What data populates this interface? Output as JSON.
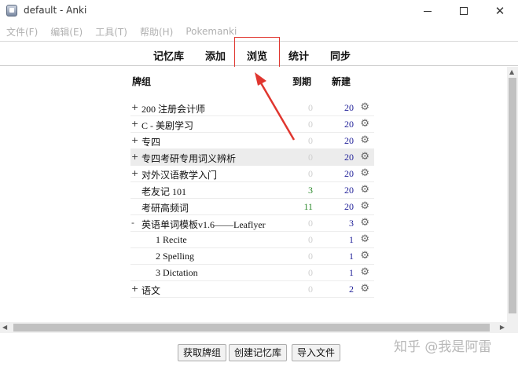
{
  "window": {
    "title": "default - Anki"
  },
  "menu": [
    "文件(F)",
    "编辑(E)",
    "工具(T)",
    "帮助(H)",
    "Pokemanki"
  ],
  "toolbar": {
    "decks": "记忆库",
    "add": "添加",
    "browse": "浏览",
    "stats": "统计",
    "sync": "同步"
  },
  "columns": {
    "deck": "牌组",
    "due": "到期",
    "new": "新建"
  },
  "decks": [
    {
      "toggle": "+",
      "name": "200 注册会计师",
      "due": "0",
      "new": "20",
      "indent": 0,
      "highlight": false
    },
    {
      "toggle": "+",
      "name": "C - 美剧学习",
      "due": "0",
      "new": "20",
      "indent": 0,
      "highlight": false
    },
    {
      "toggle": "+",
      "name": "专四",
      "due": "0",
      "new": "20",
      "indent": 0,
      "highlight": false
    },
    {
      "toggle": "+",
      "name": "专四考研专用词义辨析",
      "due": "0",
      "new": "20",
      "indent": 0,
      "highlight": true
    },
    {
      "toggle": "+",
      "name": "对外汉语教学入门",
      "due": "0",
      "new": "20",
      "indent": 0,
      "highlight": false
    },
    {
      "toggle": "",
      "name": "老友记 101",
      "due": "3",
      "new": "20",
      "indent": 0,
      "highlight": false
    },
    {
      "toggle": "",
      "name": "考研高频词",
      "due": "11",
      "new": "20",
      "indent": 0,
      "highlight": false
    },
    {
      "toggle": "-",
      "name": "英语单词模板v1.6——Leaflyer",
      "due": "0",
      "new": "3",
      "indent": 0,
      "highlight": false
    },
    {
      "toggle": "",
      "name": "1 Recite",
      "due": "0",
      "new": "1",
      "indent": 1,
      "highlight": false
    },
    {
      "toggle": "",
      "name": "2 Spelling",
      "due": "0",
      "new": "1",
      "indent": 1,
      "highlight": false
    },
    {
      "toggle": "",
      "name": "3 Dictation",
      "due": "0",
      "new": "1",
      "indent": 1,
      "highlight": false
    },
    {
      "toggle": "+",
      "name": "语文",
      "due": "0",
      "new": "2",
      "indent": 0,
      "highlight": false
    }
  ],
  "buttons": {
    "shared": "获取牌组",
    "create": "创建记忆库",
    "import": "导入文件"
  },
  "watermark": "知乎 @我是阿雷",
  "colors": {
    "due_positive": "#2d8a2d",
    "due_zero": "#cfcfcf",
    "new_count": "#23239a",
    "annotation": "#e0362f"
  },
  "icons": {
    "deck_options": "gear-icon",
    "annotation": "red-arrow"
  }
}
